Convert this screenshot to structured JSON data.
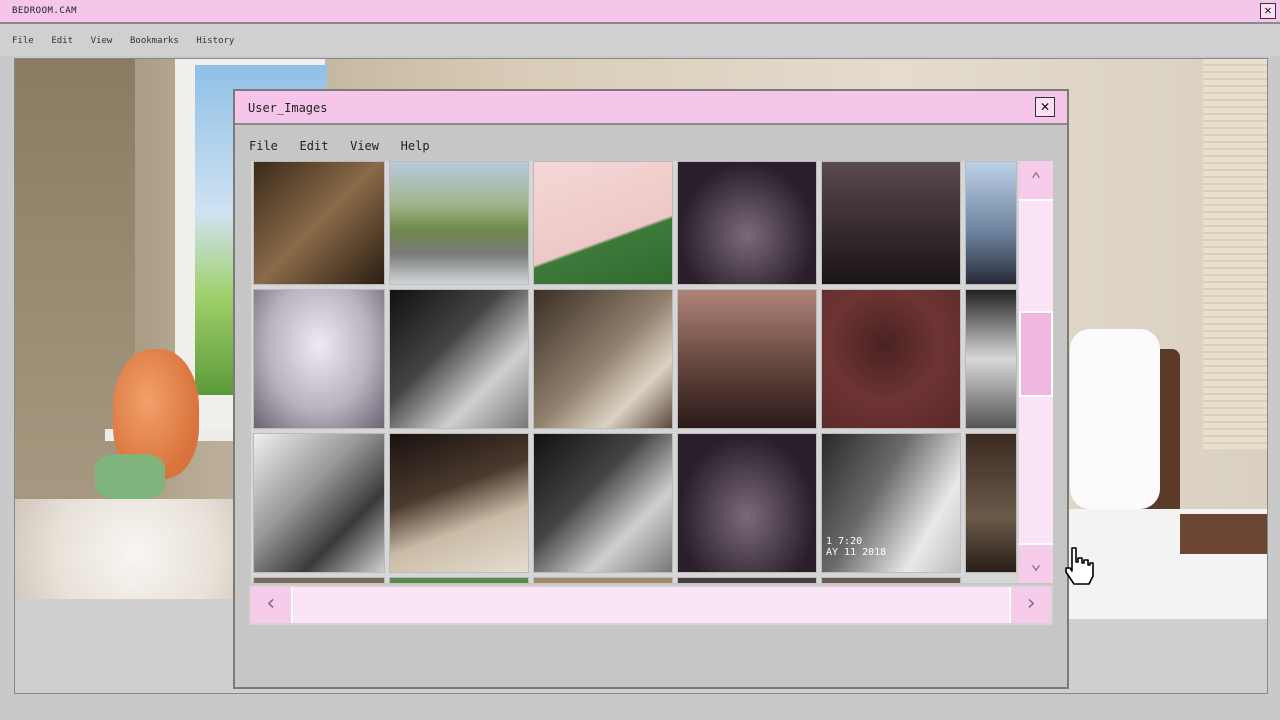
{
  "outer": {
    "title": "BEDROOM.CAM",
    "close_label": "✕",
    "menu": [
      "File",
      "Edit",
      "View",
      "Bookmarks",
      "History"
    ]
  },
  "dialog": {
    "title": "User_Images",
    "close_label": "✕",
    "menu": [
      "File",
      "Edit",
      "View",
      "Help"
    ],
    "timestamp_overlay": [
      "1  7:20",
      "AY 11 2018"
    ]
  },
  "scroll": {
    "up_icon": "chevron-up-icon",
    "down_icon": "chevron-down-icon",
    "left_icon": "chevron-left-icon",
    "right_icon": "chevron-right-icon"
  },
  "colors": {
    "accent_pink": "#f5c6ea",
    "scroll_pink": "#fbe4f5"
  }
}
